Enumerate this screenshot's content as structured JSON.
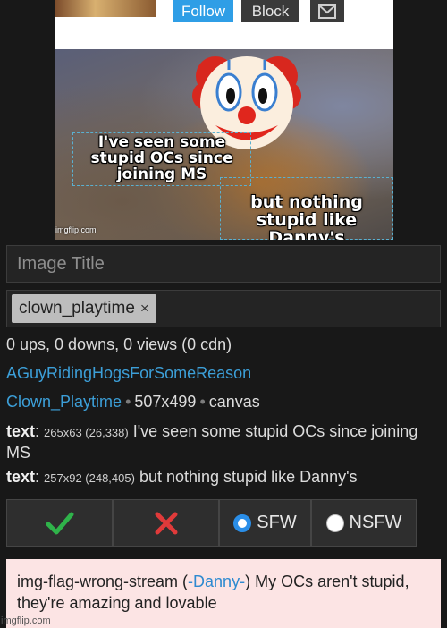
{
  "profile": {
    "follow_label": "Follow",
    "block_label": "Block",
    "message_icon": "envelope-icon"
  },
  "meme": {
    "top_text": "I've seen some stupid OCs since joining MS",
    "bottom_text": "but nothing stupid like Danny's",
    "watermark": "imgflip.com",
    "emoji": "clown-face"
  },
  "form": {
    "title_placeholder": "Image Title",
    "tag": "clown_playtime",
    "tag_remove": "×"
  },
  "stats": "0 ups, 0 downs, 0 views (0 cdn)",
  "uploader": "AGuyRidingHogsForSomeReason",
  "meta": {
    "stream": "Clown_Playtime",
    "size": "507x499",
    "source": "canvas"
  },
  "text_boxes": [
    {
      "label": "text",
      "dims": "265x63 (26,338)",
      "content": "I've seen some stupid OCs since joining MS"
    },
    {
      "label": "text",
      "dims": "257x92 (248,405)",
      "content": "but nothing stupid like Danny's"
    }
  ],
  "moderation": {
    "approve_icon": "check-icon",
    "reject_icon": "x-icon",
    "sfw_label": "SFW",
    "nsfw_label": "NSFW",
    "selected": "SFW",
    "approve_color": "#2fb34a",
    "reject_color": "#e03a3a",
    "radio_color": "#2a8ee8"
  },
  "comment": {
    "prefix": "img-flag-wrong-stream (",
    "user": "-Danny-",
    "body": ") My OCs aren't stupid, they're amazing and lovable"
  },
  "footer_watermark": "imgflip.com"
}
